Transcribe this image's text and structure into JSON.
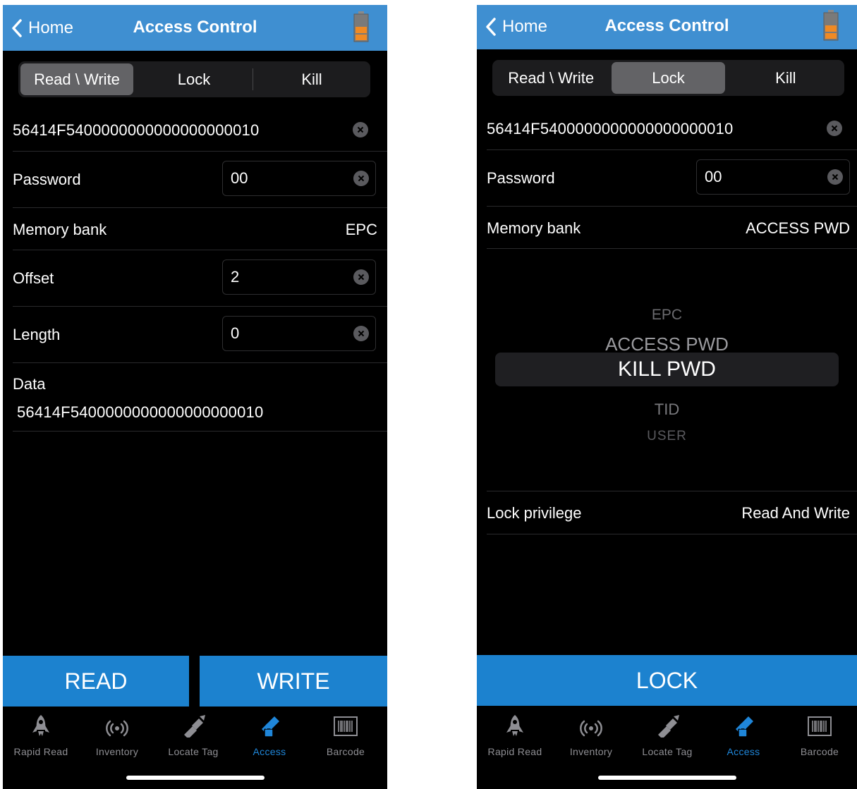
{
  "left": {
    "nav": {
      "back_label": "Home",
      "title": "Access Control"
    },
    "segments": [
      "Read \\ Write",
      "Lock",
      "Kill"
    ],
    "active_segment": "Read \\ Write",
    "epc": "56414F5400000000000000000010",
    "password": {
      "label": "Password",
      "value": "00"
    },
    "memory_bank": {
      "label": "Memory bank",
      "value": "EPC"
    },
    "offset": {
      "label": "Offset",
      "value": "2"
    },
    "length": {
      "label": "Length",
      "value": "0"
    },
    "data": {
      "label": "Data",
      "value": "56414F5400000000000000000010"
    },
    "buttons": {
      "read": "READ",
      "write": "WRITE"
    }
  },
  "right": {
    "nav": {
      "back_label": "Home",
      "title": "Access Control"
    },
    "segments": [
      "Read \\ Write",
      "Lock",
      "Kill"
    ],
    "active_segment": "Lock",
    "epc": "56414F5400000000000000000010",
    "password": {
      "label": "Password",
      "value": "00"
    },
    "memory_bank": {
      "label": "Memory bank",
      "value": "ACCESS PWD"
    },
    "picker": {
      "options": [
        "EPC",
        "ACCESS PWD",
        "KILL PWD",
        "TID",
        "USER"
      ],
      "selected": "KILL PWD"
    },
    "lock_privilege": {
      "label": "Lock privilege",
      "value": "Read And Write"
    },
    "buttons": {
      "lock": "LOCK"
    }
  },
  "tabbar": {
    "items": [
      "Rapid Read",
      "Inventory",
      "Locate Tag",
      "Access",
      "Barcode"
    ],
    "active": "Access",
    "icons": [
      "rocket-icon",
      "rfid-waves-icon",
      "flashlight-icon",
      "lock-tag-icon",
      "barcode-icon"
    ]
  },
  "colors": {
    "navbar": "#3f8fd1",
    "button": "#1c82cf",
    "active_tab": "#1f86d9",
    "battery_fill": "#f08a24"
  }
}
